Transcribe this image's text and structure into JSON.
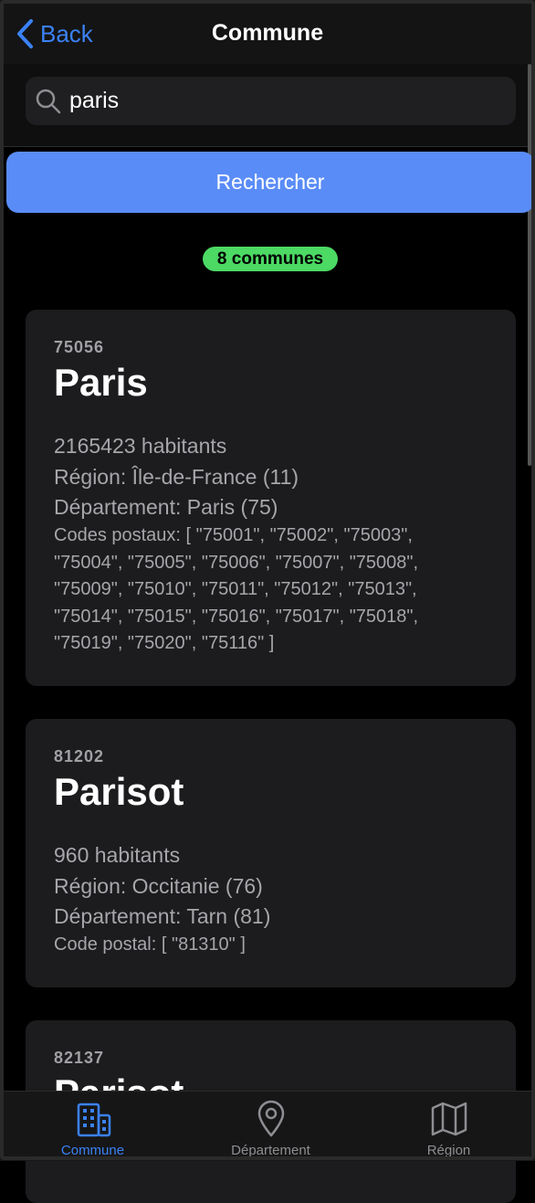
{
  "nav": {
    "back_label": "Back",
    "title": "Commune"
  },
  "search": {
    "value": "paris",
    "placeholder": ""
  },
  "button": {
    "label": "Rechercher"
  },
  "result_count": "8 communes",
  "communes": [
    {
      "code": "75056",
      "name": "Paris",
      "population": "2165423 habitants",
      "region": "Région: Île-de-France (11)",
      "departement": "Département: Paris (75)",
      "postal_lines": [
        "Codes postaux: [ \"75001\", \"75002\", \"75003\",",
        "\"75004\", \"75005\", \"75006\", \"75007\", \"75008\",",
        "\"75009\", \"75010\", \"75011\", \"75012\", \"75013\",",
        "\"75014\", \"75015\", \"75016\", \"75017\", \"75018\",",
        "\"75019\", \"75020\", \"75116\" ]"
      ]
    },
    {
      "code": "81202",
      "name": "Parisot",
      "population": "960 habitants",
      "region": "Région: Occitanie (76)",
      "departement": "Département: Tarn (81)",
      "postal_lines": [
        "Code postal: [ \"81310\" ]"
      ]
    },
    {
      "code": "82137",
      "name": "Parisot"
    }
  ],
  "tabs": [
    {
      "label": "Commune",
      "icon": "building-icon",
      "active": true
    },
    {
      "label": "Département",
      "icon": "location-pin-icon",
      "active": false
    },
    {
      "label": "Région",
      "icon": "map-icon",
      "active": false
    }
  ],
  "colors": {
    "accent": "#3b82f6",
    "button": "#5a8cf7",
    "badge": "#4cd964",
    "card": "#1c1c1e",
    "inactive_tab": "#8e8e93"
  }
}
